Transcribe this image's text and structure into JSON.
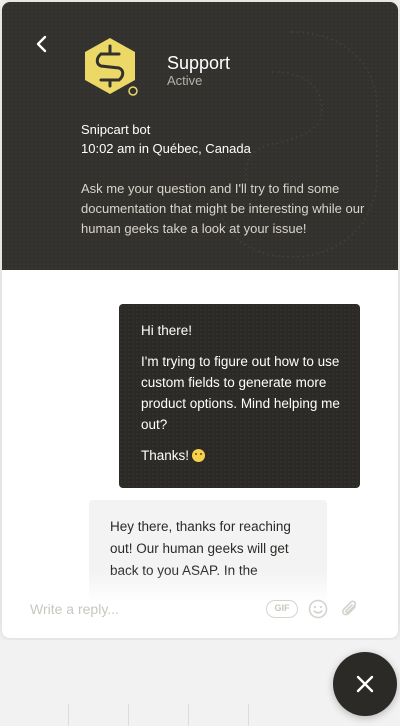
{
  "header": {
    "agent_name": "Support",
    "agent_status": "Active",
    "bot_name": "Snipcart bot",
    "bot_time": "10:02 am in Québec, Canada",
    "intro": "Ask me your question and I'll try to find some documentation that might be interesting while our human geeks take a look at your issue!"
  },
  "messages": {
    "user": {
      "line1": "Hi there!",
      "line2": "I'm trying to figure out how to use custom fields to generate more product options. Mind helping me out?",
      "line3": "Thanks!"
    },
    "bot": {
      "text": "Hey there, thanks for reaching out! Our human geeks will get back to you ASAP. In the"
    }
  },
  "composer": {
    "placeholder": "Write a reply...",
    "gif_label": "GIF"
  },
  "icons": {
    "back": "chevron-left-icon",
    "logo": "snipcart-logo",
    "emoji": "smiley-icon",
    "attach": "paperclip-icon",
    "close": "close-icon"
  },
  "colors": {
    "header_bg": "#33312e",
    "user_bubble": "#2b2a27",
    "bot_bubble": "#f3f3f3",
    "logo_yellow": "#ecd867"
  }
}
